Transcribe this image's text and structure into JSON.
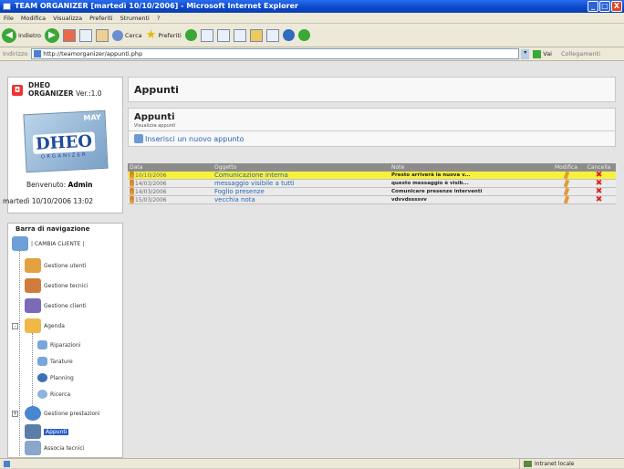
{
  "window": {
    "title": "TEAM ORGANIZER [martedì 10/10/2006] - Microsoft Internet Explorer",
    "btn_min": "_",
    "btn_max": "□",
    "btn_close": "X"
  },
  "menu": [
    "File",
    "Modifica",
    "Visualizza",
    "Preferiti",
    "Strumenti",
    "?"
  ],
  "toolbar": {
    "back": "Indietro",
    "search": "Cerca",
    "favorites": "Preferiti"
  },
  "address": {
    "label": "Indirizzo",
    "url": "http://teamorganizer/appunti.php",
    "go": "Vai",
    "links": "Collegamenti"
  },
  "sidebar": {
    "app_name": "DHEO",
    "app_sub": "ORGANIZER",
    "app_ver": "Ver.:1.0",
    "logo": {
      "month": "MAY",
      "brand": "DHEO",
      "sub": "ORGANIZER"
    },
    "welcome_prefix": "Benvenuto:",
    "welcome_user": "Admin",
    "datetime": "martedì 10/10/2006 13:02",
    "nav_title": "Barra di navigazione",
    "nav": [
      {
        "label": "| CAMBIA CLIENTE |",
        "icon": "users-icon"
      },
      {
        "label": "Gestione utenti",
        "icon": "users-icon"
      },
      {
        "label": "Gestione tecnici",
        "icon": "technician-icon"
      },
      {
        "label": "Gestione clienti",
        "icon": "client-icon"
      },
      {
        "label": "Agenda",
        "icon": "calendar-icon"
      },
      {
        "label": "Riparazioni",
        "icon": "repair-icon"
      },
      {
        "label": "Tarature",
        "icon": "calibration-icon"
      },
      {
        "label": "Planning",
        "icon": "clock-icon"
      },
      {
        "label": "Ricerca",
        "icon": "search-icon"
      },
      {
        "label": "Gestione prestazioni",
        "icon": "globe-icon"
      },
      {
        "label": "Appunti",
        "icon": "notes-icon"
      },
      {
        "label": "Associa tecnici",
        "icon": "link-icon"
      }
    ]
  },
  "main": {
    "header": "Appunti",
    "panel_title": "Appunti",
    "panel_sub": "Visualizza appunti",
    "add_link": "Inserisci un nuovo appunto",
    "columns": {
      "data": "Data",
      "oggetto": "Oggetto",
      "note": "Note",
      "modifica": "Modifica",
      "cancella": "Cancella"
    },
    "rows": [
      {
        "data": "10/10/2006",
        "oggetto": "Comunicazione interna",
        "note": "Presto arriverà la nuova v...",
        "highlight": true
      },
      {
        "data": "14/03/2006",
        "oggetto": "messaggio visibile a tutti",
        "note": "questo messaggio è visib..."
      },
      {
        "data": "14/03/2006",
        "oggetto": "Foglio presenze",
        "note": "Comunicare presenze interventi"
      },
      {
        "data": "15/03/2006",
        "oggetto": "vecchia nota",
        "note": "vdvvdssssvv"
      }
    ],
    "delete_glyph": "✖"
  },
  "status": {
    "zone": "Intranet locale"
  },
  "colors": {
    "highlight": "#f7f13c",
    "link": "#2a62b8",
    "delete": "#e02020",
    "title_bar": "#0a47c9"
  }
}
